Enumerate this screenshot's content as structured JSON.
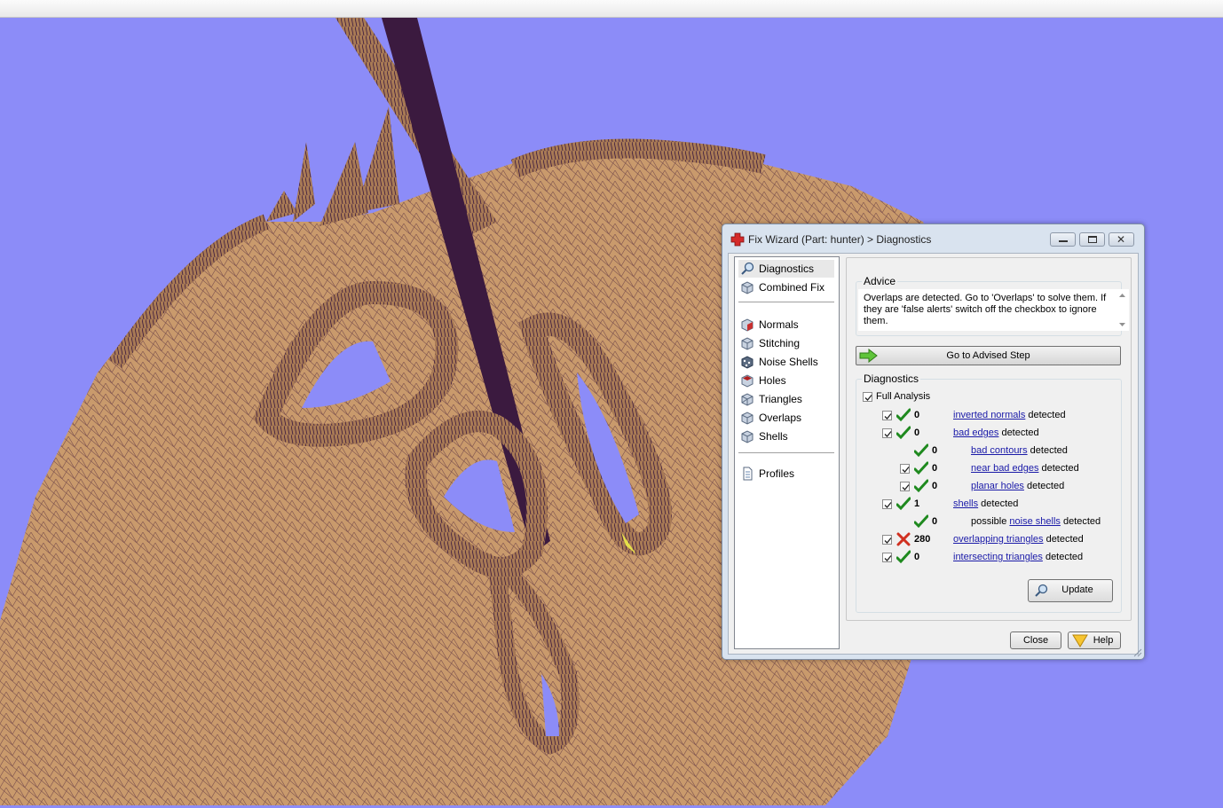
{
  "window": {
    "title": "Fix Wizard (Part: hunter) > Diagnostics"
  },
  "nav": {
    "items": [
      {
        "label": "Diagnostics",
        "icon": "magnifier-icon"
      },
      {
        "label": "Combined Fix",
        "icon": "cube-icon"
      },
      {
        "label": "Normals",
        "icon": "normals-cube-icon"
      },
      {
        "label": "Stitching",
        "icon": "stitching-cube-icon"
      },
      {
        "label": "Noise Shells",
        "icon": "noise-shells-icon"
      },
      {
        "label": "Holes",
        "icon": "holes-cube-icon"
      },
      {
        "label": "Triangles",
        "icon": "triangles-cube-icon"
      },
      {
        "label": "Overlaps",
        "icon": "overlaps-cube-icon"
      },
      {
        "label": "Shells",
        "icon": "shells-cube-icon"
      },
      {
        "label": "Profiles",
        "icon": "document-icon"
      }
    ]
  },
  "advice": {
    "label": "Advice",
    "text": "Overlaps are detected. Go to 'Overlaps' to solve them. If they are 'false alerts' switch off the checkbox to ignore them."
  },
  "advised_button": "Go to Advised Step",
  "diagnostics": {
    "label": "Diagnostics",
    "full_analysis": "Full Analysis",
    "detected": "detected",
    "rows": [
      {
        "value": "0",
        "link": "inverted normals",
        "status": "ok"
      },
      {
        "value": "0",
        "link": "bad edges",
        "status": "ok"
      },
      {
        "value": "0",
        "link": "bad contours",
        "status": "ok"
      },
      {
        "value": "0",
        "link": "near bad edges",
        "status": "ok"
      },
      {
        "value": "0",
        "link": "planar holes",
        "status": "ok"
      },
      {
        "value": "1",
        "link": "shells",
        "status": "ok"
      },
      {
        "value": "0",
        "prefix": "possible",
        "link": "noise shells",
        "status": "ok"
      },
      {
        "value": "280",
        "link": "overlapping triangles",
        "status": "error"
      },
      {
        "value": "0",
        "link": "intersecting triangles",
        "status": "ok"
      }
    ]
  },
  "buttons": {
    "update": "Update",
    "close": "Close",
    "help": "Help"
  },
  "colors": {
    "background": "#8c8cf8",
    "mesh": "#c99a6c",
    "mesh_dark": "#3b1a3f",
    "ok": "#1f8a1f",
    "error": "#d03020",
    "link": "#1a1aa8"
  }
}
